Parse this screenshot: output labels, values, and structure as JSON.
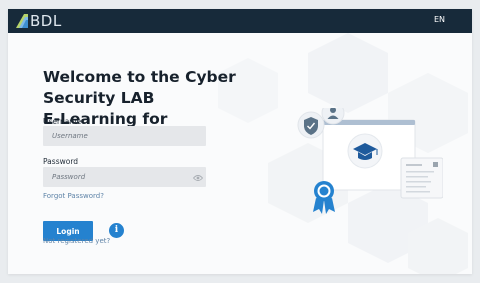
{
  "header": {
    "logo_text": "BDL",
    "language": "EN"
  },
  "login": {
    "title_line1": "Welcome to the Cyber Security LAB",
    "title_line2": "E-Learning for administrators!",
    "username_label": "Username",
    "username_placeholder": "Username",
    "username_value": "",
    "password_label": "Password",
    "password_placeholder": "Password",
    "password_value": "",
    "forgot_link": "Forgot Password?",
    "login_button": "Login",
    "info_icon_glyph": "i",
    "register_link": "Not registered yet?"
  },
  "colors": {
    "topbar": "#172a3a",
    "accent": "#2582cf",
    "link": "#5f84a8"
  },
  "icons": {
    "logo": "bdl-logo-icon",
    "eye": "eye-icon",
    "info": "info-icon",
    "shield": "shield-check-icon",
    "user": "user-icon",
    "graduation": "graduation-cap-icon",
    "badge": "award-badge-icon",
    "certificate": "certificate-icon"
  }
}
